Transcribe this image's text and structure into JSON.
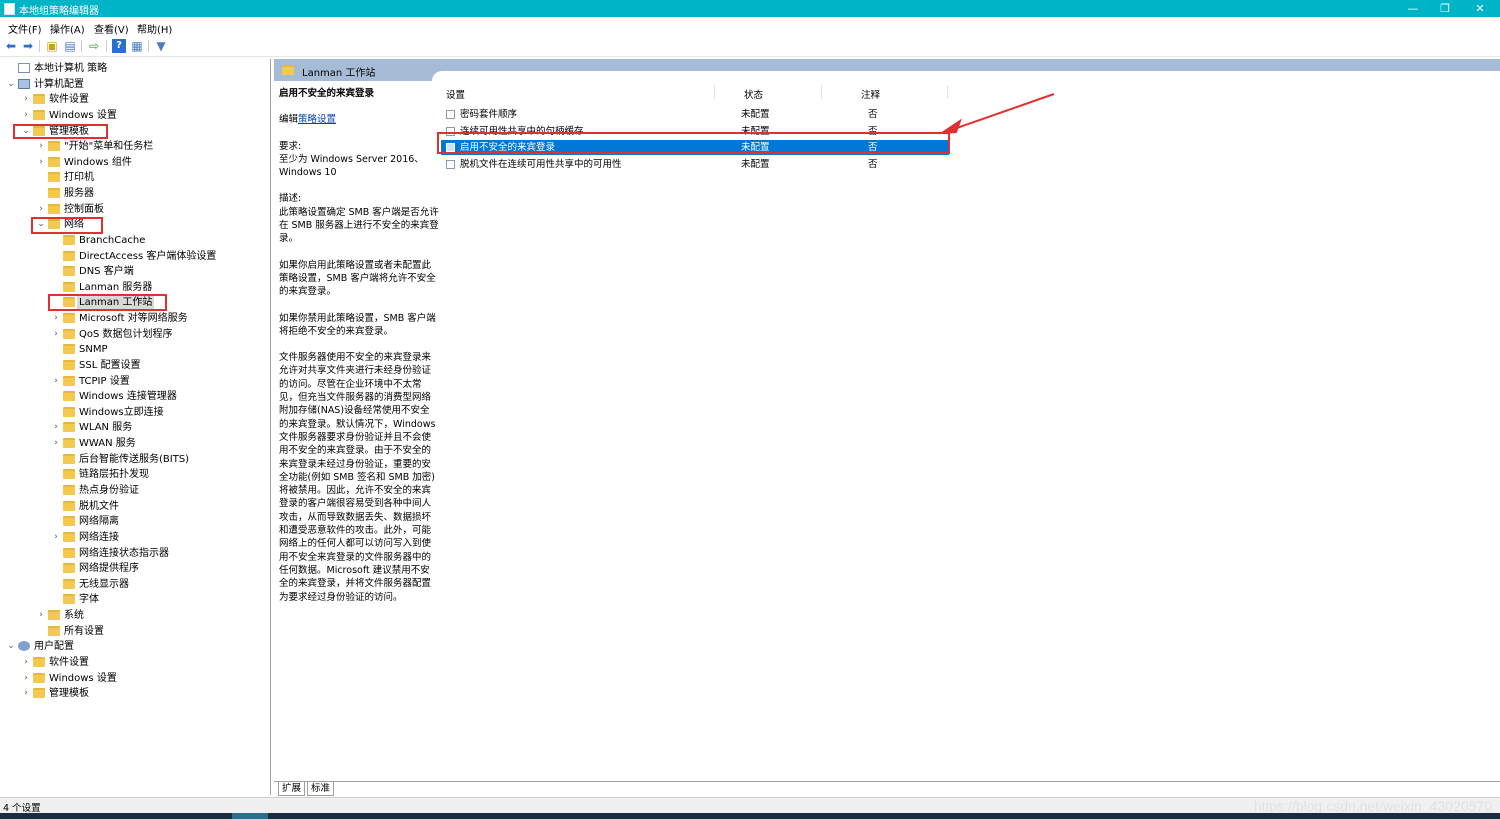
{
  "window": {
    "title": "本地组策略编辑器"
  },
  "menu": [
    "文件(F)",
    "操作(A)",
    "查看(V)",
    "帮助(H)"
  ],
  "tree": [
    {
      "label": "本地计算机 策略",
      "depth": 0,
      "toggle": "",
      "icon": "doc"
    },
    {
      "label": "计算机配置",
      "depth": 0,
      "toggle": "v",
      "icon": "comp"
    },
    {
      "label": "软件设置",
      "depth": 1,
      "toggle": ">",
      "icon": "folder"
    },
    {
      "label": "Windows 设置",
      "depth": 1,
      "toggle": ">",
      "icon": "folder"
    },
    {
      "label": "管理模板",
      "depth": 1,
      "toggle": "v",
      "icon": "folder"
    },
    {
      "label": "\"开始\"菜单和任务栏",
      "depth": 2,
      "toggle": ">",
      "icon": "folder"
    },
    {
      "label": "Windows 组件",
      "depth": 2,
      "toggle": ">",
      "icon": "folder"
    },
    {
      "label": "打印机",
      "depth": 2,
      "toggle": "",
      "icon": "folder"
    },
    {
      "label": "服务器",
      "depth": 2,
      "toggle": "",
      "icon": "folder"
    },
    {
      "label": "控制面板",
      "depth": 2,
      "toggle": ">",
      "icon": "folder"
    },
    {
      "label": "网络",
      "depth": 2,
      "toggle": "v",
      "icon": "folder"
    },
    {
      "label": "BranchCache",
      "depth": 3,
      "toggle": "",
      "icon": "folder"
    },
    {
      "label": "DirectAccess 客户端体验设置",
      "depth": 3,
      "toggle": "",
      "icon": "folder"
    },
    {
      "label": "DNS 客户端",
      "depth": 3,
      "toggle": "",
      "icon": "folder"
    },
    {
      "label": "Lanman 服务器",
      "depth": 3,
      "toggle": "",
      "icon": "folder"
    },
    {
      "label": "Lanman 工作站",
      "depth": 3,
      "toggle": "",
      "icon": "folder",
      "selected": true
    },
    {
      "label": "Microsoft 对等网络服务",
      "depth": 3,
      "toggle": ">",
      "icon": "folder"
    },
    {
      "label": "QoS 数据包计划程序",
      "depth": 3,
      "toggle": ">",
      "icon": "folder"
    },
    {
      "label": "SNMP",
      "depth": 3,
      "toggle": "",
      "icon": "folder"
    },
    {
      "label": "SSL 配置设置",
      "depth": 3,
      "toggle": "",
      "icon": "folder"
    },
    {
      "label": "TCPIP 设置",
      "depth": 3,
      "toggle": ">",
      "icon": "folder"
    },
    {
      "label": "Windows 连接管理器",
      "depth": 3,
      "toggle": "",
      "icon": "folder"
    },
    {
      "label": "Windows立即连接",
      "depth": 3,
      "toggle": "",
      "icon": "folder"
    },
    {
      "label": "WLAN 服务",
      "depth": 3,
      "toggle": ">",
      "icon": "folder"
    },
    {
      "label": "WWAN 服务",
      "depth": 3,
      "toggle": ">",
      "icon": "folder"
    },
    {
      "label": "后台智能传送服务(BITS)",
      "depth": 3,
      "toggle": "",
      "icon": "folder"
    },
    {
      "label": "链路层拓扑发现",
      "depth": 3,
      "toggle": "",
      "icon": "folder"
    },
    {
      "label": "热点身份验证",
      "depth": 3,
      "toggle": "",
      "icon": "folder"
    },
    {
      "label": "脱机文件",
      "depth": 3,
      "toggle": "",
      "icon": "folder"
    },
    {
      "label": "网络隔离",
      "depth": 3,
      "toggle": "",
      "icon": "folder"
    },
    {
      "label": "网络连接",
      "depth": 3,
      "toggle": ">",
      "icon": "folder"
    },
    {
      "label": "网络连接状态指示器",
      "depth": 3,
      "toggle": "",
      "icon": "folder"
    },
    {
      "label": "网络提供程序",
      "depth": 3,
      "toggle": "",
      "icon": "folder"
    },
    {
      "label": "无线显示器",
      "depth": 3,
      "toggle": "",
      "icon": "folder"
    },
    {
      "label": "字体",
      "depth": 3,
      "toggle": "",
      "icon": "folder"
    },
    {
      "label": "系统",
      "depth": 2,
      "toggle": ">",
      "icon": "folder"
    },
    {
      "label": "所有设置",
      "depth": 2,
      "toggle": "",
      "icon": "folder"
    },
    {
      "label": "用户配置",
      "depth": 0,
      "toggle": "v",
      "icon": "user"
    },
    {
      "label": "软件设置",
      "depth": 1,
      "toggle": ">",
      "icon": "folder"
    },
    {
      "label": "Windows 设置",
      "depth": 1,
      "toggle": ">",
      "icon": "folder"
    },
    {
      "label": "管理模板",
      "depth": 1,
      "toggle": ">",
      "icon": "folder"
    }
  ],
  "right": {
    "header": "Lanman 工作站",
    "description": {
      "title": "启用不安全的来宾登录",
      "edit_prefix": "编辑",
      "edit_link": "策略设置",
      "requirements_label": "要求:",
      "requirements": "至少为 Windows Server 2016、Windows 10",
      "desc_label": "描述:",
      "paragraphs": [
        "此策略设置确定 SMB 客户端是否允许在 SMB 服务器上进行不安全的来宾登录。",
        "如果你启用此策略设置或者未配置此策略设置，SMB 客户端将允许不安全的来宾登录。",
        "如果你禁用此策略设置，SMB 客户端将拒绝不安全的来宾登录。",
        "文件服务器使用不安全的来宾登录来允许对共享文件夹进行未经身份验证的访问。尽管在企业环境中不太常见，但充当文件服务器的消费型网络附加存储(NAS)设备经常使用不安全的来宾登录。默认情况下，Windows 文件服务器要求身份验证并且不会使用不安全的来宾登录。由于不安全的来宾登录未经过身份验证，重要的安全功能(例如 SMB 签名和 SMB 加密)将被禁用。因此，允许不安全的来宾登录的客户端很容易受到各种中间人攻击，从而导致数据丢失、数据损坏和遭受恶意软件的攻击。此外，可能网络上的任何人都可以访问写入到使用不安全来宾登录的文件服务器中的任何数据。Microsoft 建议禁用不安全的来宾登录，并将文件服务器配置为要求经过身份验证的访问。"
      ]
    },
    "columns": {
      "setting": "设置",
      "state": "状态",
      "comment": "注释"
    },
    "rows": [
      {
        "name": "密码套件顺序",
        "state": "未配置",
        "comment": "否"
      },
      {
        "name": "连续可用性共享中的句柄缓存",
        "state": "未配置",
        "comment": "否"
      },
      {
        "name": "启用不安全的来宾登录",
        "state": "未配置",
        "comment": "否",
        "selected": true
      },
      {
        "name": "脱机文件在连续可用性共享中的可用性",
        "state": "未配置",
        "comment": "否"
      }
    ],
    "tabs": [
      "扩展",
      "标准"
    ]
  },
  "status": {
    "text": "4 个设置"
  },
  "watermark": "https://blog.csdn.net/weixin_43020570",
  "colors": {
    "titlebar": "#00b4c8",
    "selection": "#0078d7",
    "highlight": "#e03030"
  }
}
